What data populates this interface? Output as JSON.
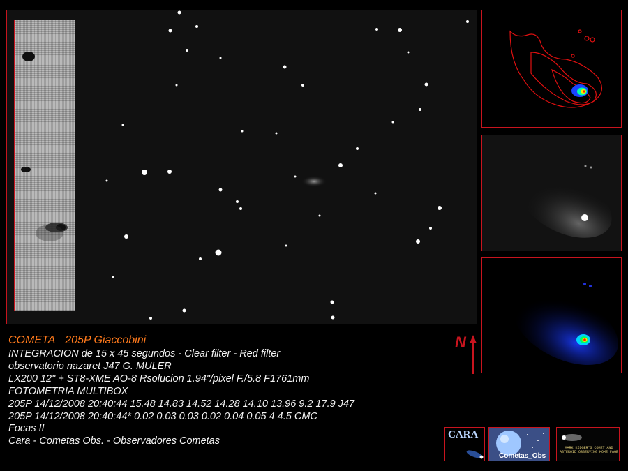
{
  "title": {
    "prefix": "COMETA",
    "name": "205P Giaccobini"
  },
  "lines": [
    "INTEGRACION de 15 x 45 segundos - Clear filter - Red filter",
    "observatorio nazaret J47  G. MULER",
    "LX200 12\" +  ST8-XME AO-8  Rsolucion 1.94\"/pixel   F./5.8   F1761mm",
    "FOTOMETRIA MULTIBOX",
    "205P  14/12/2008 20:40:44  15.48  14.83  14.52  14.28  14.10  13.96   9.2  17.9  J47",
    "205P  14/12/2008 20:40:44*  0.02   0.03   0.03   0.02   0.04   0.05     4   4.5  CMC",
    "Focas II",
    "Cara - Cometas Obs. - Observadores Cometas"
  ],
  "north_label": "N",
  "logos": {
    "cara": "CARA",
    "cometas": "Cometas_Obs",
    "kidger": "MARK KIDGER'S COMET AND ASTEROID OBSERVING HOME PAGE"
  },
  "colors": {
    "frame": "#c8141e",
    "title": "#ff7a1c",
    "text": "#f2f2f2",
    "background": "#000000"
  }
}
